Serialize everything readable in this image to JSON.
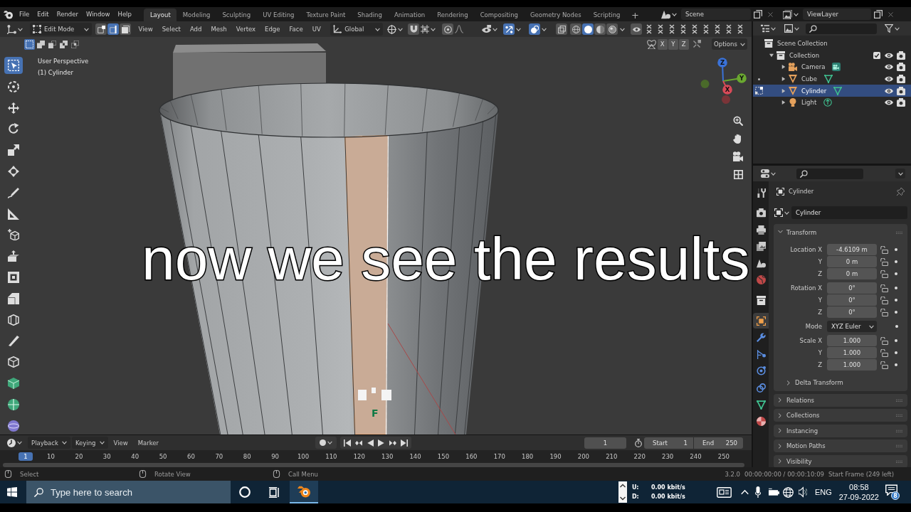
{
  "menu_bar": {
    "menus": [
      "File",
      "Edit",
      "Render",
      "Window",
      "Help"
    ],
    "workspaces": [
      {
        "label": "Layout",
        "selected": true
      },
      {
        "label": "Modeling",
        "selected": false
      },
      {
        "label": "Sculpting",
        "selected": false
      },
      {
        "label": "UV Editing",
        "selected": false
      },
      {
        "label": "Texture Paint",
        "selected": false
      },
      {
        "label": "Shading",
        "selected": false
      },
      {
        "label": "Animation",
        "selected": false
      },
      {
        "label": "Rendering",
        "selected": false
      },
      {
        "label": "Compositing",
        "selected": false
      },
      {
        "label": "Geometry Nodes",
        "selected": false
      },
      {
        "label": "Scripting",
        "selected": false
      }
    ],
    "add_workspace": "+",
    "scene": "Scene",
    "view_layer": "ViewLayer"
  },
  "viewport": {
    "mode": "Edit Mode",
    "select_modes": [
      {
        "kind": "vertex",
        "selected": false
      },
      {
        "kind": "edge",
        "selected": true
      },
      {
        "kind": "face",
        "selected": false
      }
    ],
    "menus": [
      "View",
      "Select",
      "Add",
      "Mesh",
      "Vertex",
      "Edge",
      "Face",
      "UV"
    ],
    "orientation": "Global",
    "toggles": [
      {
        "kind": "snap",
        "on": false
      },
      {
        "kind": "proportional",
        "on": false
      },
      {
        "kind": "gizmo",
        "on": true
      },
      {
        "kind": "overlay",
        "on": true
      },
      {
        "kind": "xray",
        "on": false
      }
    ],
    "shading": [
      {
        "kind": "wireframe",
        "selected": false
      },
      {
        "kind": "solid",
        "selected": true
      },
      {
        "kind": "material",
        "selected": false
      },
      {
        "kind": "rendered",
        "selected": false
      }
    ],
    "box_modes": [
      {
        "kind": "set",
        "selected": true
      },
      {
        "kind": "extend",
        "selected": false
      },
      {
        "kind": "subtract",
        "selected": false
      },
      {
        "kind": "invert",
        "selected": false
      },
      {
        "kind": "intersect",
        "selected": false
      }
    ],
    "mirror_axes": [
      "X",
      "Y",
      "Z"
    ],
    "options": "Options",
    "view_name": "User Perspective",
    "object_label": "(1) Cylinder",
    "gizmo_axes": [
      "X",
      "Y",
      "Z"
    ],
    "tools": [
      {
        "kind": "select",
        "selected": true
      },
      {
        "kind": "cursor",
        "selected": false
      },
      {
        "kind": "move",
        "selected": false
      },
      {
        "kind": "rotate",
        "selected": false
      },
      {
        "kind": "scale",
        "selected": false
      },
      {
        "kind": "transform",
        "selected": false
      },
      {
        "kind": "annotate",
        "selected": false
      },
      {
        "kind": "measure",
        "selected": false
      },
      {
        "kind": "add-cube",
        "selected": false
      },
      {
        "kind": "extrude",
        "selected": false
      },
      {
        "kind": "inset",
        "selected": false
      },
      {
        "kind": "bevel",
        "selected": false
      },
      {
        "kind": "loop-cut",
        "selected": false
      },
      {
        "kind": "knife",
        "selected": false
      },
      {
        "kind": "poly-build",
        "selected": false
      },
      {
        "kind": "spin",
        "selected": false
      },
      {
        "kind": "smooth",
        "selected": false
      },
      {
        "kind": "shrink",
        "selected": false
      }
    ],
    "marker_letter": "F"
  },
  "caption": "now we see the results",
  "outliner": {
    "tree": {
      "label": "Scene Collection",
      "kind": "collection",
      "selected": false,
      "children": [
        {
          "label": "Collection",
          "kind": "collection",
          "expanded": true,
          "checked": true,
          "visible": true,
          "render": true,
          "selected": false,
          "children": [
            {
              "label": "Camera",
              "kind": "camera",
              "expanded": false,
              "visible": true,
              "render": true,
              "selected": false
            },
            {
              "label": "Cube",
              "kind": "mesh",
              "expanded": false,
              "edit_mode": false,
              "visible": true,
              "render": true,
              "selected": false
            },
            {
              "label": "Cylinder",
              "kind": "mesh",
              "expanded": false,
              "edit_mode": true,
              "visible": true,
              "render": true,
              "selected": true
            },
            {
              "label": "Light",
              "kind": "light",
              "expanded": false,
              "visible": true,
              "render": true,
              "selected": false
            }
          ]
        }
      ]
    }
  },
  "properties": {
    "tabs": [
      {
        "kind": "tool",
        "selected": false
      },
      {
        "kind": "render",
        "selected": false
      },
      {
        "kind": "output",
        "selected": false
      },
      {
        "kind": "view-layer",
        "selected": false
      },
      {
        "kind": "scene",
        "selected": false
      },
      {
        "kind": "world",
        "selected": false
      },
      {
        "kind": "collection",
        "selected": false
      },
      {
        "kind": "object",
        "selected": true
      },
      {
        "kind": "modifiers",
        "selected": false
      },
      {
        "kind": "particles",
        "selected": false
      },
      {
        "kind": "physics",
        "selected": false
      },
      {
        "kind": "constraints",
        "selected": false
      },
      {
        "kind": "data",
        "selected": false
      },
      {
        "kind": "material",
        "selected": false
      }
    ],
    "object": "Cylinder",
    "name": "Cylinder",
    "transform": {
      "title": "Transform",
      "expanded": true,
      "groups": [
        {
          "rows": [
            {
              "label": "Location X",
              "value": "-4.6109 m",
              "kind": "number",
              "locked": false
            },
            {
              "label": "Y",
              "value": "0 m",
              "kind": "number",
              "locked": false
            },
            {
              "label": "Z",
              "value": "0 m",
              "kind": "number",
              "locked": false
            }
          ]
        },
        {
          "rows": [
            {
              "label": "Rotation X",
              "value": "0°",
              "kind": "number",
              "locked": false
            },
            {
              "label": "Y",
              "value": "0°",
              "kind": "number",
              "locked": false
            },
            {
              "label": "Z",
              "value": "0°",
              "kind": "number",
              "locked": false
            }
          ]
        },
        {
          "rows": [
            {
              "label": "Mode",
              "value": "XYZ Euler",
              "kind": "dropdown"
            }
          ]
        },
        {
          "rows": [
            {
              "label": "Scale X",
              "value": "1.000",
              "kind": "number",
              "locked": false
            },
            {
              "label": "Y",
              "value": "1.000",
              "kind": "number",
              "locked": false
            },
            {
              "label": "Z",
              "value": "1.000",
              "kind": "number",
              "locked": false
            }
          ]
        }
      ],
      "subpanel": {
        "title": "Delta Transform",
        "expanded": false
      }
    },
    "panels": [
      {
        "title": "Relations",
        "expanded": false
      },
      {
        "title": "Collections",
        "expanded": false
      },
      {
        "title": "Instancing",
        "expanded": false
      },
      {
        "title": "Motion Paths",
        "expanded": false
      },
      {
        "title": "Visibility",
        "expanded": false
      }
    ]
  },
  "timeline": {
    "menus": [
      {
        "label": "Playback",
        "kind": "dropdown"
      },
      {
        "label": "Keying",
        "kind": "dropdown"
      },
      {
        "label": "View",
        "kind": "menu"
      },
      {
        "label": "Marker",
        "kind": "menu"
      }
    ],
    "auto_keying": false,
    "current_frame": "1",
    "start_label": "Start",
    "start": "1",
    "end_label": "End",
    "end": "250",
    "ruler": [
      {
        "label": "1",
        "selected": true
      },
      {
        "label": "10",
        "selected": false
      },
      {
        "label": "20",
        "selected": false
      },
      {
        "label": "30",
        "selected": false
      },
      {
        "label": "40",
        "selected": false
      },
      {
        "label": "50",
        "selected": false
      },
      {
        "label": "60",
        "selected": false
      },
      {
        "label": "70",
        "selected": false
      },
      {
        "label": "80",
        "selected": false
      },
      {
        "label": "90",
        "selected": false
      },
      {
        "label": "100",
        "selected": false
      },
      {
        "label": "110",
        "selected": false
      },
      {
        "label": "120",
        "selected": false
      },
      {
        "label": "130",
        "selected": false
      },
      {
        "label": "140",
        "selected": false
      },
      {
        "label": "150",
        "selected": false
      },
      {
        "label": "160",
        "selected": false
      },
      {
        "label": "170",
        "selected": false
      },
      {
        "label": "180",
        "selected": false
      },
      {
        "label": "190",
        "selected": false
      },
      {
        "label": "200",
        "selected": false
      },
      {
        "label": "210",
        "selected": false
      },
      {
        "label": "220",
        "selected": false
      },
      {
        "label": "230",
        "selected": false
      },
      {
        "label": "240",
        "selected": false
      },
      {
        "label": "250",
        "selected": false
      }
    ]
  },
  "status_bar": {
    "hints": [
      "Select",
      "Rotate View",
      "Call Menu"
    ],
    "version": "3.2.0",
    "timecode": "00:00:00:00 / 00:00:10:09",
    "frame_info": "Start Frame (249 left)"
  },
  "taskbar": {
    "search_placeholder": "Type here to search",
    "apps": [
      {
        "kind": "blender",
        "selected": true
      }
    ],
    "upload_label": "U:",
    "upload": "0.00 kbit/s",
    "download_label": "D:",
    "download": "0.00 kbit/s",
    "language": "ENG",
    "time": "08:58",
    "date": "27-09-2022",
    "notifications": "8"
  }
}
